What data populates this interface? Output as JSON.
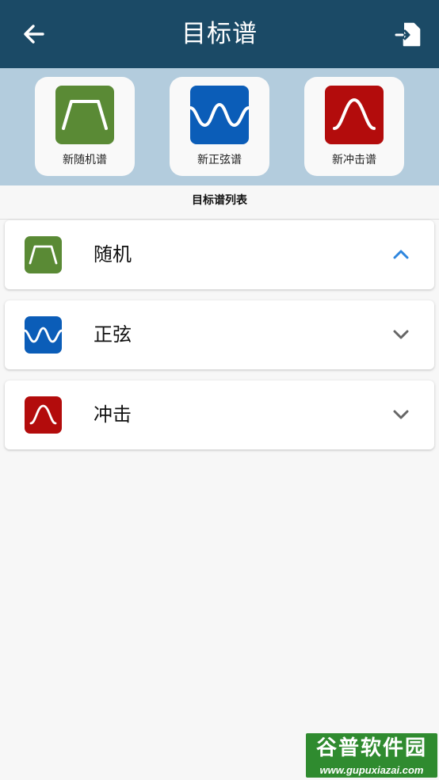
{
  "appbar": {
    "title": "目标谱",
    "back_icon": "arrow-left-icon",
    "import_icon": "file-import-icon",
    "bg_color": "#1b4a66"
  },
  "quick_actions": [
    {
      "label": "新随机谱",
      "icon": "trapezoid-wave-icon",
      "color": "#5a8a35"
    },
    {
      "label": "新正弦谱",
      "icon": "sine-wave-icon",
      "color": "#0b5db8"
    },
    {
      "label": "新冲击谱",
      "icon": "pulse-wave-icon",
      "color": "#b30c0c"
    }
  ],
  "list": {
    "title": "目标谱列表",
    "items": [
      {
        "label": "随机",
        "icon": "trapezoid-wave-icon",
        "color": "#5a8a35",
        "expanded": true
      },
      {
        "label": "正弦",
        "icon": "sine-wave-icon",
        "color": "#0b5db8",
        "expanded": false
      },
      {
        "label": "冲击",
        "icon": "pulse-wave-icon",
        "color": "#b30c0c",
        "expanded": false
      }
    ]
  },
  "watermark": {
    "text": "谷普软件园",
    "url": "www.gupuxiazai.com"
  }
}
